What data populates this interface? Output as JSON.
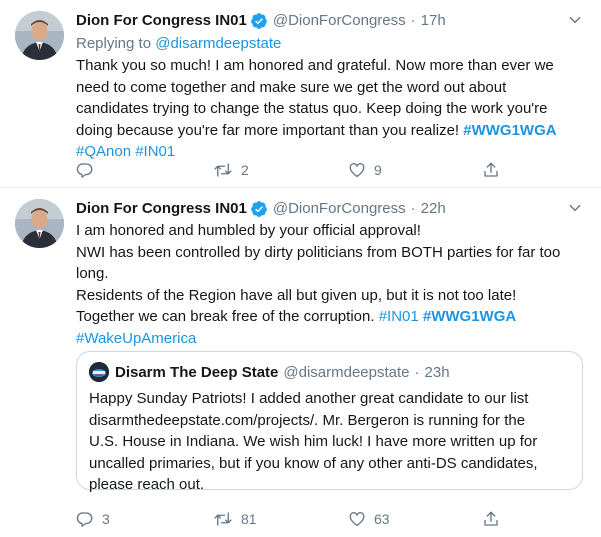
{
  "tweets": [
    {
      "author_name": "Dion For Congress IN01",
      "handle": "@DionForCongress",
      "separator": "·",
      "time": "17h",
      "replying_prefix": "Replying to ",
      "replying_to": "@disarmdeepstate",
      "text_line1": "Thank you so much! I am honored and grateful. Now more than ever we",
      "text_line2": "need to come together and make sure we get the word out about",
      "text_line3": "candidates trying to change the status quo. Keep doing the work you're",
      "text_line4": "doing because you're far more important than you realize! ",
      "hashtag_wwg1wga": "#WWG1WGA",
      "hashtag_qanon": "#QAnon",
      "hashtag_in01": "#IN01",
      "reply_count": "",
      "retweet_count": "2",
      "like_count": "9"
    },
    {
      "author_name": "Dion For Congress IN01",
      "handle": "@DionForCongress",
      "separator": "·",
      "time": "22h",
      "line1": "I am honored and humbled by your official approval!",
      "line2": "NWI has been controlled by dirty politicians from BOTH parties for far too",
      "line3": "long.",
      "line4": "Residents of the Region have all but given up, but it is not too late!",
      "line5": "Together we can break free of the corruption. ",
      "hashtag_in01": "#IN01",
      "hashtag_wwg1wga": "#WWG1WGA",
      "hashtag_wakeup": "#WakeUpAmerica",
      "quote": {
        "author_name": "Disarm The Deep State",
        "handle": "@disarmdeepstate",
        "separator": "·",
        "time": "23h",
        "line1": "Happy Sunday Patriots!  I added another great candidate to our list",
        "line2": "disarmthedeepstate.com/projects/.  Mr. Bergeron is running for the",
        "line3": "U.S. House in Indiana. We wish him luck! I have more written up for",
        "line4": "uncalled primaries, but if you know of any other anti-DS candidates,",
        "line5": "please reach out."
      },
      "reply_count": "3",
      "retweet_count": "81",
      "like_count": "63"
    }
  ],
  "icons": {
    "verified": "verified-badge-icon",
    "caret": "chevron-down-icon",
    "reply": "reply-icon",
    "retweet": "retweet-icon",
    "like": "heart-icon",
    "share": "share-icon"
  },
  "colors": {
    "link": "#1b95e0",
    "muted": "#657786",
    "text": "#14171a",
    "divider": "#e6ecf0",
    "verified": "#1da1f2"
  }
}
